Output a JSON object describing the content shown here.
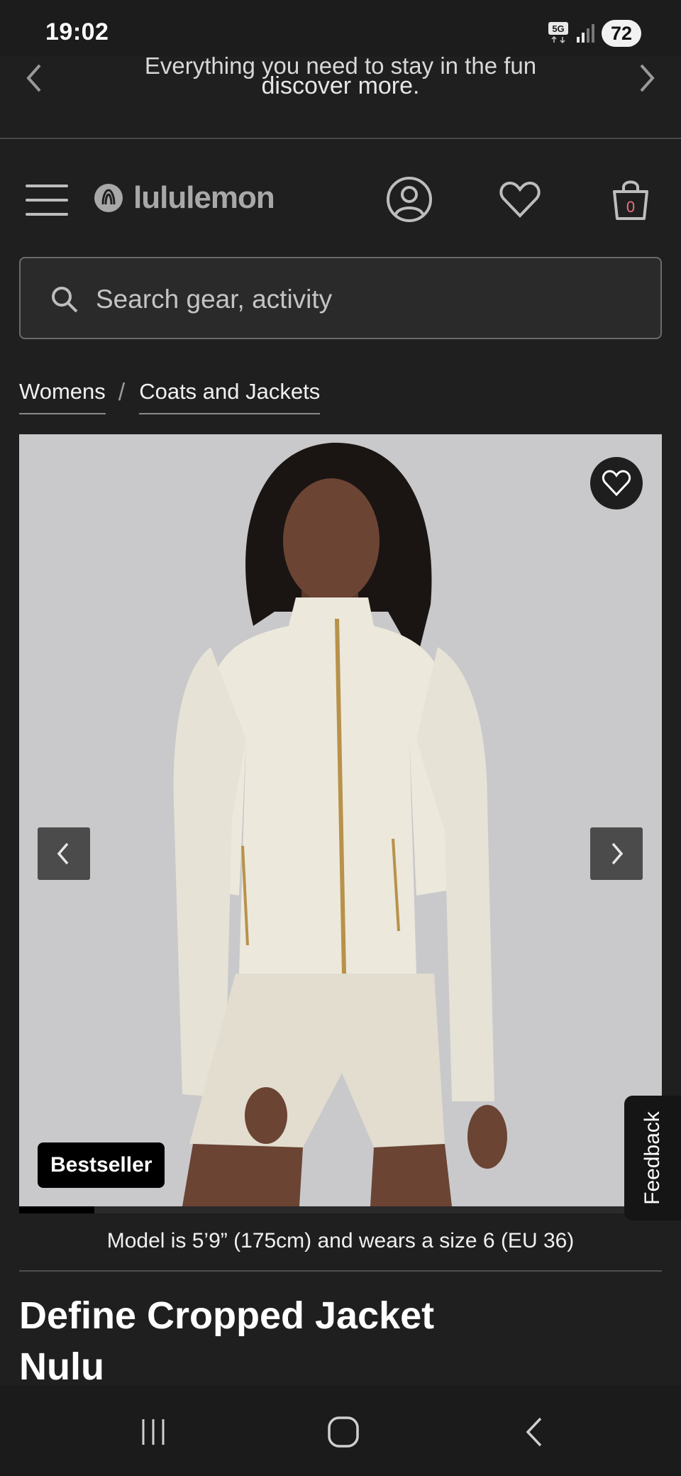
{
  "status_bar": {
    "time": "19:02",
    "network": "5G",
    "battery": "72"
  },
  "promo": {
    "line1": "Everything you need to stay in the fun",
    "line2": "discover more."
  },
  "header": {
    "brand": "lululemon",
    "cart_count": "0"
  },
  "search": {
    "placeholder": "Search gear, activity"
  },
  "breadcrumb": {
    "items": [
      "Womens",
      "Coats and Jackets"
    ],
    "separator": "/"
  },
  "gallery": {
    "badge": "Bestseller",
    "progress_fraction": 0.12,
    "image_alt": "Model wearing a cream zip-up cropped jacket and matching shorts"
  },
  "feedback": {
    "label": "Feedback"
  },
  "product": {
    "model_caption": "Model is 5’9” (175cm) and wears a size 6 (EU 36)",
    "title_line1": "Define Cropped Jacket",
    "title_line2": "Nulu"
  },
  "colors": {
    "background": "#1f1f20",
    "image_bg": "#c9c9cb",
    "cart_count": "#e8747c",
    "jacket": "#ece8dc"
  },
  "icons": {
    "menu": "hamburger-icon",
    "account": "account-icon",
    "wishlist": "heart-icon",
    "cart": "shopping-bag-icon",
    "search": "search-icon",
    "prev": "chevron-left-icon",
    "next": "chevron-right-icon"
  }
}
